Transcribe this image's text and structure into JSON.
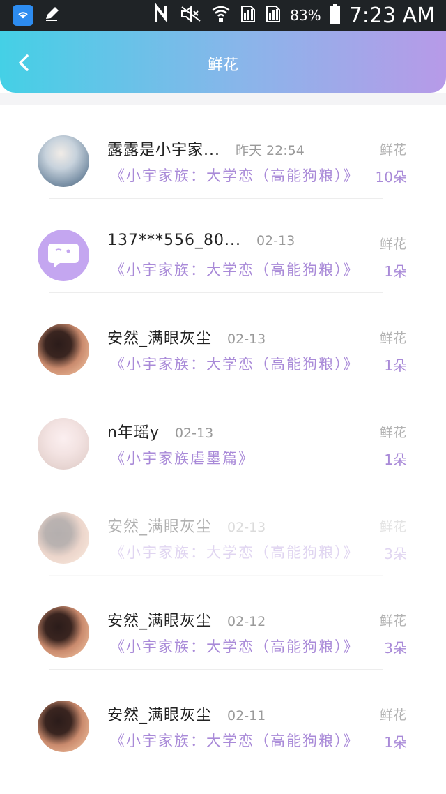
{
  "status_bar": {
    "battery_percent": "83%",
    "time": "7:23 AM"
  },
  "header": {
    "title": "鲜花"
  },
  "items": [
    {
      "username": "露露是小宇家...",
      "time": "昨天 22:54",
      "label": "鲜花",
      "book": "《小宇家族：大学恋（高能狗粮）》",
      "count": "10朵"
    },
    {
      "username": "137***556_80...",
      "time": "02-13",
      "label": "鲜花",
      "book": "《小宇家族：大学恋（高能狗粮）》",
      "count": "1朵"
    },
    {
      "username": "安然_满眼灰尘",
      "time": "02-13",
      "label": "鲜花",
      "book": "《小宇家族：大学恋（高能狗粮）》",
      "count": "1朵"
    },
    {
      "username": "n年瑶y",
      "time": "02-13",
      "label": "鲜花",
      "book": "《小宇家族虐墨篇》",
      "count": "1朵"
    },
    {
      "username": "安然_满眼灰尘",
      "time": "02-13",
      "label": "鲜花",
      "book": "《小宇家族：大学恋（高能狗粮）》",
      "count": "3朵"
    },
    {
      "username": "安然_满眼灰尘",
      "time": "02-12",
      "label": "鲜花",
      "book": "《小宇家族：大学恋（高能狗粮）》",
      "count": "3朵"
    },
    {
      "username": "安然_满眼灰尘",
      "time": "02-11",
      "label": "鲜花",
      "book": "《小宇家族：大学恋（高能狗粮）》",
      "count": "1朵"
    }
  ]
}
